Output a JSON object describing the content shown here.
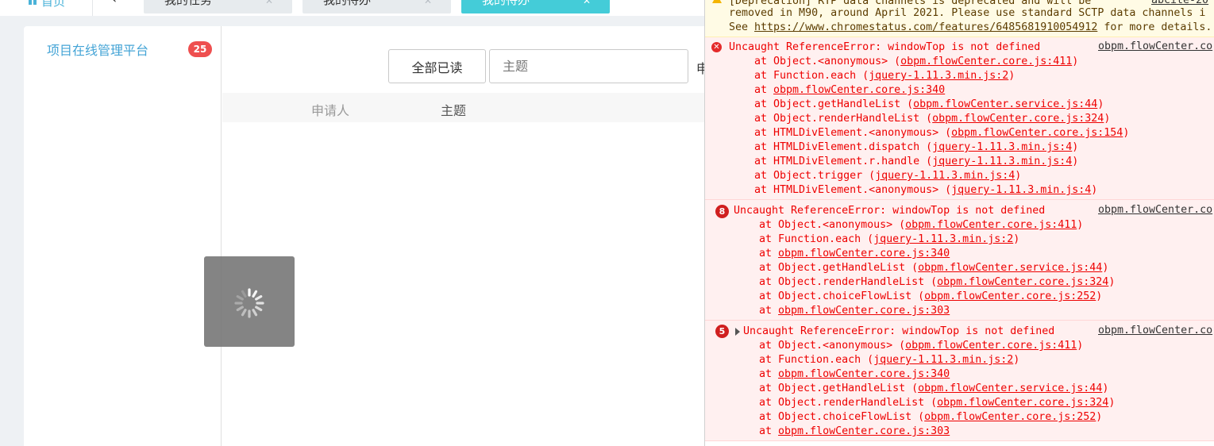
{
  "topbar": {
    "home_label": "首页",
    "back_glyph": "‹",
    "tabs": [
      {
        "label": "我的任务",
        "close": "✕"
      },
      {
        "label": "我的待办",
        "close": "✕"
      },
      {
        "label": "我的待办",
        "close": "✕"
      }
    ]
  },
  "sidebar": {
    "items": [
      {
        "label": "项目在线管理平台",
        "badge": "25"
      }
    ]
  },
  "toolbar": {
    "read_all_label": "全部已读",
    "subject_placeholder": "主题",
    "extra_label": "申"
  },
  "table": {
    "columns": [
      "申请人",
      "主题"
    ]
  },
  "console": {
    "warning": {
      "line1": "[Deprecation] RTP data channels is deprecated and will be",
      "line1_src": "abcite-20",
      "line2": "removed in M90, around April 2021. Please use standard SCTP data channels i",
      "line3_prefix": "See ",
      "line3_link": "https://www.chromestatus.com/features/6485681910054912",
      "line3_suffix": " for more details."
    },
    "errors": [
      {
        "count": "",
        "message": "Uncaught ReferenceError: windowTop is not defined",
        "source": "obpm.flowCenter.co",
        "frames": [
          {
            "fn": "at Object.<anonymous> (",
            "loc": "obpm.flowCenter.core.js:411",
            "end": ")"
          },
          {
            "fn": "at Function.each (",
            "loc": "jquery-1.11.3.min.js:2",
            "end": ")"
          },
          {
            "fn": "at ",
            "loc": "obpm.flowCenter.core.js:340",
            "end": ""
          },
          {
            "fn": "at Object.getHandleList (",
            "loc": "obpm.flowCenter.service.js:44",
            "end": ")"
          },
          {
            "fn": "at Object.renderHandleList (",
            "loc": "obpm.flowCenter.core.js:324",
            "end": ")"
          },
          {
            "fn": "at HTMLDivElement.<anonymous> (",
            "loc": "obpm.flowCenter.core.js:154",
            "end": ")"
          },
          {
            "fn": "at HTMLDivElement.dispatch (",
            "loc": "jquery-1.11.3.min.js:4",
            "end": ")"
          },
          {
            "fn": "at HTMLDivElement.r.handle (",
            "loc": "jquery-1.11.3.min.js:4",
            "end": ")"
          },
          {
            "fn": "at Object.trigger (",
            "loc": "jquery-1.11.3.min.js:4",
            "end": ")"
          },
          {
            "fn": "at HTMLDivElement.<anonymous> (",
            "loc": "jquery-1.11.3.min.js:4",
            "end": ")"
          }
        ]
      },
      {
        "count": "8",
        "message": "Uncaught ReferenceError: windowTop is not defined",
        "source": "obpm.flowCenter.co",
        "frames": [
          {
            "fn": "at Object.<anonymous> (",
            "loc": "obpm.flowCenter.core.js:411",
            "end": ")"
          },
          {
            "fn": "at Function.each (",
            "loc": "jquery-1.11.3.min.js:2",
            "end": ")"
          },
          {
            "fn": "at ",
            "loc": "obpm.flowCenter.core.js:340",
            "end": ""
          },
          {
            "fn": "at Object.getHandleList (",
            "loc": "obpm.flowCenter.service.js:44",
            "end": ")"
          },
          {
            "fn": "at Object.renderHandleList (",
            "loc": "obpm.flowCenter.core.js:324",
            "end": ")"
          },
          {
            "fn": "at Object.choiceFlowList (",
            "loc": "obpm.flowCenter.core.js:252",
            "end": ")"
          },
          {
            "fn": "at ",
            "loc": "obpm.flowCenter.core.js:303",
            "end": ""
          }
        ]
      },
      {
        "count": "5",
        "message": "Uncaught ReferenceError: windowTop is not defined",
        "source": "obpm.flowCenter.co",
        "frames": [
          {
            "fn": "at Object.<anonymous> (",
            "loc": "obpm.flowCenter.core.js:411",
            "end": ")"
          },
          {
            "fn": "at Function.each (",
            "loc": "jquery-1.11.3.min.js:2",
            "end": ")"
          },
          {
            "fn": "at ",
            "loc": "obpm.flowCenter.core.js:340",
            "end": ""
          },
          {
            "fn": "at Object.getHandleList (",
            "loc": "obpm.flowCenter.service.js:44",
            "end": ")"
          },
          {
            "fn": "at Object.renderHandleList (",
            "loc": "obpm.flowCenter.core.js:324",
            "end": ")"
          },
          {
            "fn": "at Object.choiceFlowList (",
            "loc": "obpm.flowCenter.core.js:252",
            "end": ")"
          },
          {
            "fn": "at ",
            "loc": "obpm.flowCenter.core.js:303",
            "end": ""
          }
        ]
      }
    ]
  },
  "colors": {
    "accent": "#44ccd8",
    "link": "#44a4d6",
    "badge": "#ee4f4f",
    "error_text": "#e00000",
    "error_bg": "#fff0f0",
    "warn_bg": "#fffbe5"
  }
}
